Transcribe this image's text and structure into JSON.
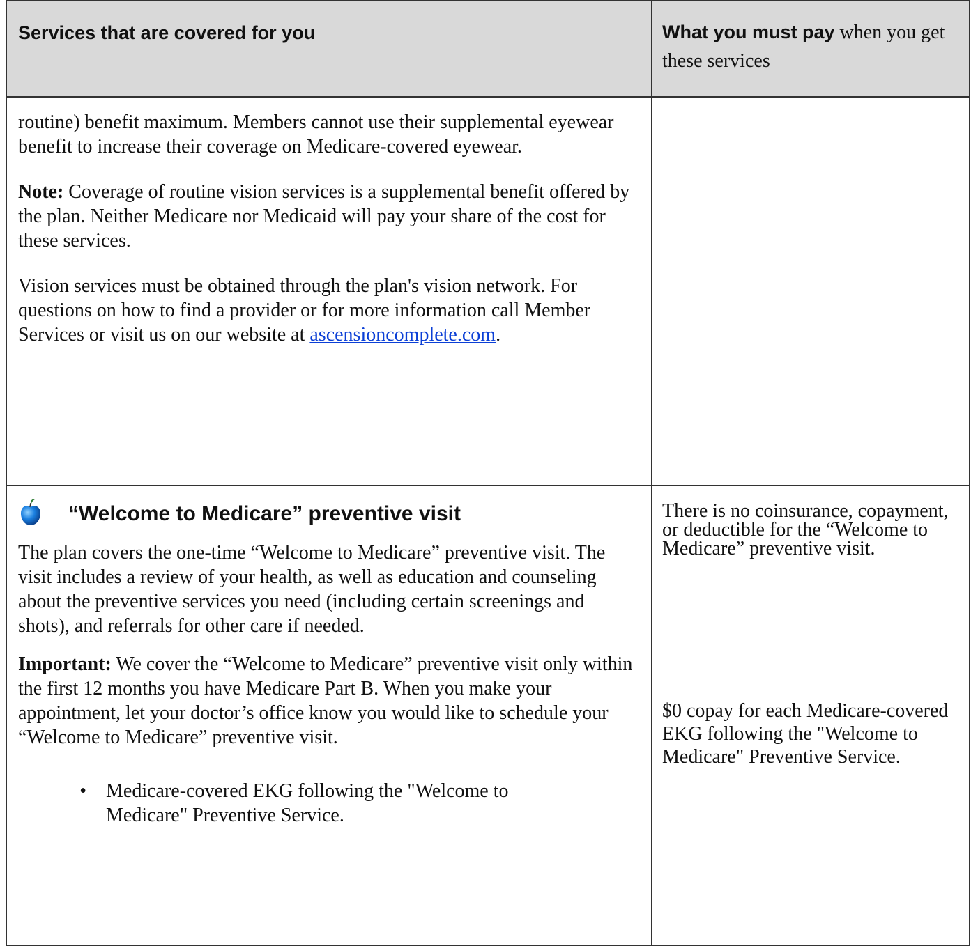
{
  "header": {
    "col1": "Services that are covered for you",
    "col2_bold": "What you must pay",
    "col2_rest": " when you get these services"
  },
  "vision": {
    "cont_text": "routine) benefit maximum. Members cannot use their supplemental eyewear benefit to increase their coverage on Medicare-covered eyewear.",
    "note_label": "Note:",
    "note_text": " Coverage of routine vision services is a supplemental benefit offered by the plan. Neither Medicare nor Medicaid will pay your share of the cost for these services.",
    "network_text": "Vision services must be obtained through the plan's vision network. For questions on how to find a provider or for more information call Member Services or visit us on our website at ",
    "link_text": "ascensioncomplete.com",
    "link_end": "."
  },
  "welcome": {
    "icon": "apple-icon",
    "title": "“Welcome to Medicare” preventive visit",
    "para1": "The plan covers the one-time “Welcome to Medicare” preventive visit. The visit includes a review of your health, as well as education and counseling about the preventive services you need (including certain screenings and shots), and referrals for other care if needed.",
    "important_label": "Important:",
    "important_text": " We cover the “Welcome to Medicare” preventive visit only within the first 12 months you have Medicare Part B. When you make your appointment, let your doctor’s office know you would like to schedule your “Welcome to Medicare” preventive visit.",
    "bullet": "•",
    "bullet_text": "Medicare-covered EKG following the \"Welcome to Medicare\" Preventive Service.",
    "pay1": "There is no coinsurance, copayment, or deductible for the “Welcome to Medicare” preventive visit.",
    "pay2": "$0 copay for each Medicare-covered EKG following the \"Welcome to Medicare\" Preventive Service."
  },
  "colors": {
    "header_bg": "#d9d9d9",
    "link": "#0b3fd6",
    "border": "#333333"
  }
}
